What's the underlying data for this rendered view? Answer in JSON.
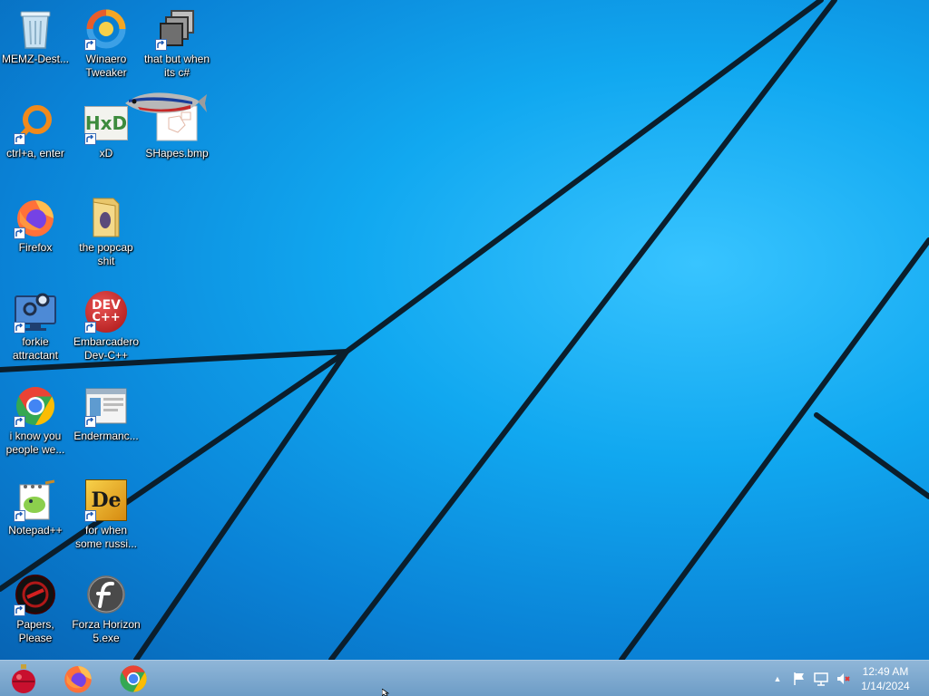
{
  "desktop": {
    "icons": [
      {
        "label": "MEMZ-Dest...",
        "icon": "recycle-bin-icon"
      },
      {
        "label": "Winaero Tweaker",
        "icon": "winaero-tweaker-icon"
      },
      {
        "label": "that but when its c#",
        "icon": "stacked-windows-icon"
      },
      {
        "label": "ctrl+a, enter",
        "icon": "orange-magnifier-icon"
      },
      {
        "label": "xD",
        "icon": "hxd-hex-editor-icon"
      },
      {
        "label": "SHapes.bmp",
        "icon": "bitmap-image-icon"
      },
      {
        "label": "Firefox",
        "icon": "firefox-icon"
      },
      {
        "label": "the popcap shit",
        "icon": "folder-icon"
      },
      {
        "label": "forkie attractant",
        "icon": "monitor-settings-icon"
      },
      {
        "label": "Embarcadero Dev-C++",
        "icon": "dev-cpp-icon"
      },
      {
        "label": "i know you people we...",
        "icon": "chrome-icon"
      },
      {
        "label": "Endermanc...",
        "icon": "window-app-icon"
      },
      {
        "label": "Notepad++",
        "icon": "notepad-plus-plus-icon"
      },
      {
        "label": "for when some russi...",
        "icon": "dependency-walker-icon"
      },
      {
        "label": "Papers, Please",
        "icon": "papers-please-icon"
      },
      {
        "label": "Forza Horizon 5.exe",
        "icon": "flash-player-icon"
      }
    ],
    "hxd_text": "HxD",
    "dev_text": "DEV",
    "dev_sub": "C++",
    "de_text": "De"
  },
  "taskbar": {
    "pinned": [
      {
        "name": "start-orb",
        "icon": "christmas-ornament-icon"
      },
      {
        "name": "firefox",
        "icon": "firefox-icon"
      },
      {
        "name": "chrome",
        "icon": "chrome-icon"
      }
    ],
    "tray": {
      "show_hidden_glyph": "▲",
      "icons": [
        "action-center-flag-icon",
        "network-icon",
        "volume-muted-icon"
      ]
    },
    "clock": {
      "time": "12:49 AM",
      "date": "1/14/2024"
    }
  }
}
